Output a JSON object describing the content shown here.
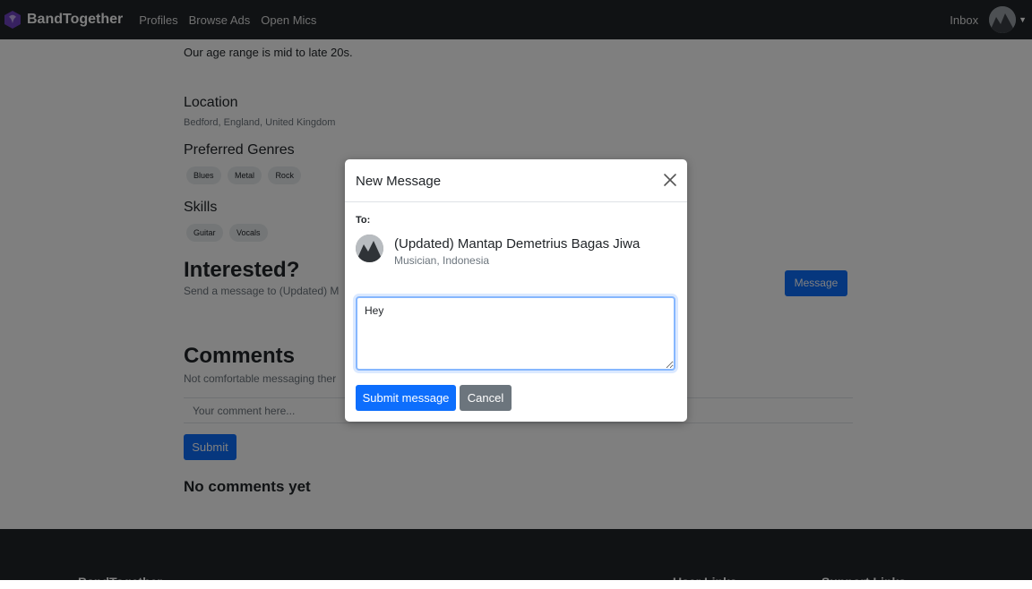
{
  "navbar": {
    "brand": "BandTogether",
    "links": [
      "Profiles",
      "Browse Ads",
      "Open Mics"
    ],
    "inbox": "Inbox"
  },
  "profile": {
    "age_text": "Our age range is mid to late 20s.",
    "location_heading": "Location",
    "location_value": "Bedford, England, United Kingdom",
    "genres_heading": "Preferred Genres",
    "genres": [
      "Blues",
      "Metal",
      "Rock"
    ],
    "skills_heading": "Skills",
    "skills": [
      "Guitar",
      "Vocals"
    ],
    "interested_heading": "Interested?",
    "interested_text": "Send a message to (Updated) M",
    "message_button": "Message",
    "comments_heading": "Comments",
    "comments_text": "Not comfortable messaging ther",
    "comment_placeholder": "Your comment here...",
    "submit_button": "Submit",
    "no_comments": "No comments yet"
  },
  "footer": {
    "brand": "BandTogether",
    "user_links": "User Links",
    "support_links": "Support Links"
  },
  "modal": {
    "title": "New Message",
    "to_label": "To:",
    "recipient_name": "(Updated) Mantap Demetrius Bagas Jiwa",
    "recipient_sub": "Musician, Indonesia",
    "message_value": "Hey",
    "submit_label": "Submit message",
    "cancel_label": "Cancel"
  }
}
